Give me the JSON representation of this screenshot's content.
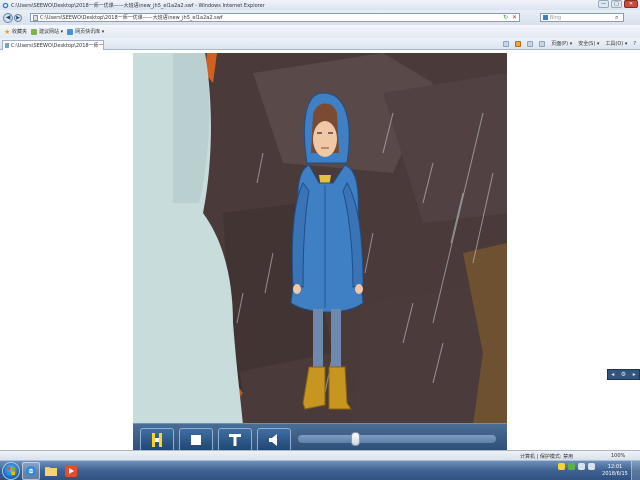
{
  "window": {
    "title": "C:\\Users\\SEEWO\\Desktop\\2018一师一优课——大班语\\new_jh5_el1a2a2.swf - Windows Internet Explorer",
    "controls": [
      "—",
      "□",
      "✕"
    ]
  },
  "address_bar": {
    "url": "C:\\Users\\SEEWO\\Desktop\\2018一师一优课——大班语\\new_jh5_el1a2a2.swf",
    "search_placeholder": "Bing",
    "back_glyph": "◀",
    "forward_glyph": "▶"
  },
  "favorites_bar": {
    "favorites_label": "收藏夹",
    "items": [
      "建议网站 ▾",
      "网页快讯库 ▾"
    ]
  },
  "tab": {
    "label": "C:\\Users\\SEEWO\\Desktop\\2018一师一优课——..."
  },
  "command_bar": {
    "items": [
      "页面(P) ▾",
      "安全(S) ▾",
      "工具(O) ▾",
      "?"
    ]
  },
  "player": {
    "controls": [
      {
        "name": "play-pause",
        "icon": "pause-icon"
      },
      {
        "name": "stop",
        "icon": "stop-icon"
      },
      {
        "name": "text",
        "icon": "text-icon"
      },
      {
        "name": "volume",
        "icon": "speaker-icon"
      }
    ],
    "progress_fraction": 0.29
  },
  "status_bar": {
    "zone": "计算机 | 保护模式: 禁用",
    "zoom": "100%"
  },
  "taskbar": {
    "clock_time": "12:01",
    "clock_date": "2018/6/15",
    "apps": [
      "ie-icon",
      "folder-icon",
      "media-icon"
    ]
  },
  "colors": {
    "raincoat": "#3f7fc4",
    "cave": "#3a2d2b",
    "taskbar": "#3f6292",
    "player_controls": "#2a4a72"
  }
}
